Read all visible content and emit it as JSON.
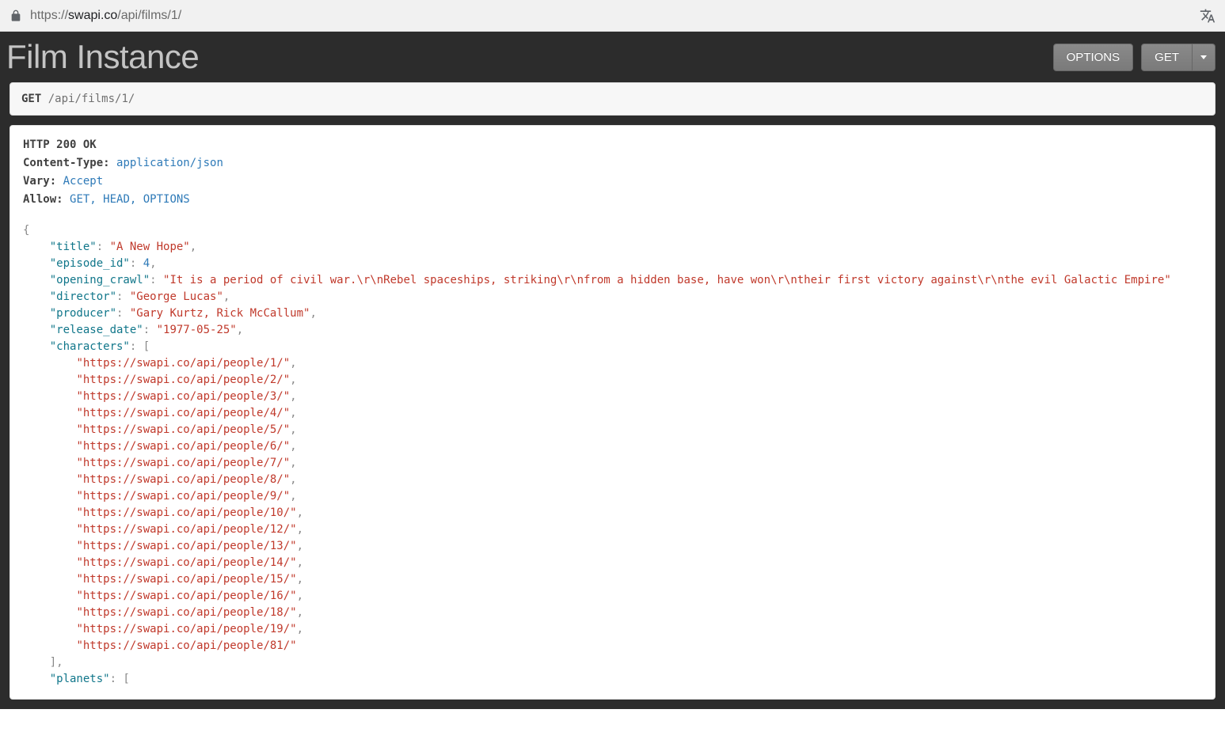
{
  "browser": {
    "url_prefix": "https://",
    "url_host": "swapi.co",
    "url_path": "/api/films/1/"
  },
  "header": {
    "title": "Film Instance",
    "options_label": "OPTIONS",
    "get_label": "GET"
  },
  "request": {
    "method": "GET",
    "path": "/api/films/1/"
  },
  "response": {
    "status_line": "HTTP 200 OK",
    "content_type_key": "Content-Type:",
    "content_type_val": "application/json",
    "vary_key": "Vary:",
    "vary_val": "Accept",
    "allow_key": "Allow:",
    "allow_val": "GET, HEAD, OPTIONS"
  },
  "json_body": {
    "title": "A New Hope",
    "episode_id": 4,
    "opening_crawl": "It is a period of civil war.\\r\\nRebel spaceships, striking\\r\\nfrom a hidden base, have won\\r\\ntheir first victory against\\r\\nthe evil Galactic Empire",
    "director": "George Lucas",
    "producer": "Gary Kurtz, Rick McCallum",
    "release_date": "1977-05-25",
    "characters": [
      "https://swapi.co/api/people/1/",
      "https://swapi.co/api/people/2/",
      "https://swapi.co/api/people/3/",
      "https://swapi.co/api/people/4/",
      "https://swapi.co/api/people/5/",
      "https://swapi.co/api/people/6/",
      "https://swapi.co/api/people/7/",
      "https://swapi.co/api/people/8/",
      "https://swapi.co/api/people/9/",
      "https://swapi.co/api/people/10/",
      "https://swapi.co/api/people/12/",
      "https://swapi.co/api/people/13/",
      "https://swapi.co/api/people/14/",
      "https://swapi.co/api/people/15/",
      "https://swapi.co/api/people/16/",
      "https://swapi.co/api/people/18/",
      "https://swapi.co/api/people/19/",
      "https://swapi.co/api/people/81/"
    ],
    "next_key_partial": "planets"
  }
}
